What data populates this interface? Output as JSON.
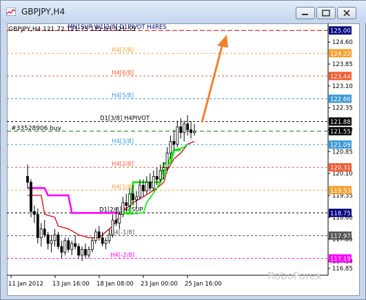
{
  "window": {
    "title": "GBPJPY,H4",
    "minimize_icon": "minimize-icon",
    "maximize_icon": "maximize-icon",
    "close_icon": "close-icon",
    "app_icon": "chart-icon"
  },
  "chart_info": {
    "symbol_line": "GBPJPY,H4  121.72 121.75 121.53 121.55",
    "order_label": "#33528906 buy",
    "watermark": "RoboForex"
  },
  "colors": {
    "candles": "#000000",
    "red_line": "#d40000",
    "magenta_line": "#ff00ff",
    "green_line": "#00ee00",
    "arrow": "#f47f2a"
  },
  "levels": [
    {
      "price": 125.0,
      "label": "MN1SUP W1[2/8] D1PIVOT H4RES",
      "tag": "125.00",
      "color": "#c80000",
      "tagcolor": "#000080",
      "style": "long"
    },
    {
      "price": 124.22,
      "label": "H4[7/8]",
      "tag": "124.22",
      "color": "#f5a030",
      "tagcolor": "#f5a030",
      "style": "dash"
    },
    {
      "price": 123.44,
      "label": "H4[6/8]",
      "tag": "123.44",
      "color": "#f05a30",
      "tagcolor": "#f05a30",
      "style": "dash"
    },
    {
      "price": 122.66,
      "label": "H4[5/8]",
      "tag": "122.66",
      "color": "#3a9ad9",
      "tagcolor": "#3a9ad9",
      "style": "dash"
    },
    {
      "price": 121.88,
      "label": "D1[3/8] H4PIVOT",
      "tag": "121.88",
      "color": "#000000",
      "tagcolor": "#000000",
      "style": "dash"
    },
    {
      "price": 121.09,
      "label": "H4[3/8]",
      "tag": "121.09",
      "color": "#3a9ad9",
      "tagcolor": "#3a9ad9",
      "style": "dash"
    },
    {
      "price": 120.31,
      "label": "H4[2/8]",
      "tag": "120.31",
      "color": "#f05a30",
      "tagcolor": "#f05a30",
      "style": "dash"
    },
    {
      "price": 119.53,
      "label": "H4[1/8]",
      "tag": "119.53",
      "color": "#f5a030",
      "tagcolor": "#f5a030",
      "style": "dash"
    },
    {
      "price": 118.75,
      "label": "D1[2/8] H4SUP",
      "tag": "118.75",
      "color": "#000000",
      "tagcolor": "#000080",
      "style": "dash"
    },
    {
      "price": 117.97,
      "label": "H4[-1/8]",
      "tag": "117.97",
      "color": "#555555",
      "tagcolor": "#555555",
      "style": "dash"
    },
    {
      "price": 117.19,
      "label": "H4[-2/8]",
      "tag": "117.19",
      "color": "#ff00ff",
      "tagcolor": "#ff00ff",
      "style": "dash"
    }
  ],
  "current_price": {
    "price": 121.55,
    "tag": "121.55"
  },
  "axis": {
    "y_ticks": [
      "124.60",
      "123.85",
      "123.10",
      "122.35",
      "121.60",
      "120.85",
      "120.10",
      "119.35",
      "118.60",
      "117.85",
      "117.10",
      "116.85"
    ],
    "y_tick_values": [
      124.6,
      123.85,
      123.1,
      122.35,
      121.6,
      120.85,
      120.1,
      119.35,
      118.6,
      117.85,
      117.1,
      116.85
    ],
    "x_ticks": [
      "11 Jan 2012",
      "13 Jan 16:00",
      "18 Jan 08:00",
      "23 Jan 00:00",
      "25 Jan 16:00"
    ],
    "ymin": 116.85,
    "ymax": 125.1
  },
  "candles": [
    [
      120.0,
      120.4,
      119.6,
      119.8
    ],
    [
      119.8,
      119.9,
      118.6,
      118.8
    ],
    [
      118.8,
      119.0,
      118.4,
      118.7
    ],
    [
      118.7,
      118.9,
      117.7,
      117.9
    ],
    [
      117.9,
      118.4,
      117.6,
      118.2
    ],
    [
      118.2,
      118.5,
      117.9,
      118.0
    ],
    [
      118.0,
      118.1,
      117.5,
      117.7
    ],
    [
      117.7,
      118.0,
      117.4,
      117.8
    ],
    [
      117.8,
      118.2,
      117.6,
      118.0
    ],
    [
      118.0,
      118.1,
      117.5,
      117.6
    ],
    [
      117.6,
      117.8,
      117.2,
      117.4
    ],
    [
      117.4,
      117.9,
      117.3,
      117.8
    ],
    [
      117.8,
      117.9,
      117.4,
      117.5
    ],
    [
      117.5,
      117.8,
      117.3,
      117.7
    ],
    [
      117.7,
      118.0,
      117.5,
      117.6
    ],
    [
      117.6,
      117.7,
      117.2,
      117.3
    ],
    [
      117.3,
      117.6,
      117.1,
      117.5
    ],
    [
      117.5,
      117.7,
      117.2,
      117.3
    ],
    [
      117.3,
      117.6,
      117.2,
      117.5
    ],
    [
      117.5,
      117.9,
      117.4,
      117.8
    ],
    [
      117.8,
      118.2,
      117.7,
      118.1
    ],
    [
      118.1,
      118.3,
      117.8,
      117.9
    ],
    [
      117.9,
      118.1,
      117.6,
      117.7
    ],
    [
      117.7,
      117.9,
      117.5,
      117.8
    ],
    [
      117.8,
      118.2,
      117.7,
      118.0
    ],
    [
      118.0,
      118.7,
      117.9,
      118.5
    ],
    [
      118.5,
      118.9,
      118.3,
      118.4
    ],
    [
      118.4,
      118.8,
      118.2,
      118.7
    ],
    [
      118.7,
      119.3,
      118.6,
      119.1
    ],
    [
      119.1,
      119.4,
      118.8,
      119.0
    ],
    [
      119.0,
      119.6,
      118.9,
      119.4
    ],
    [
      119.4,
      119.7,
      119.0,
      119.2
    ],
    [
      119.2,
      119.5,
      118.9,
      119.3
    ],
    [
      119.3,
      119.9,
      119.2,
      119.7
    ],
    [
      119.7,
      119.9,
      119.3,
      119.5
    ],
    [
      119.5,
      120.0,
      119.4,
      119.8
    ],
    [
      119.8,
      120.1,
      119.5,
      119.6
    ],
    [
      119.6,
      120.2,
      119.5,
      120.0
    ],
    [
      120.0,
      120.3,
      119.7,
      119.9
    ],
    [
      119.9,
      120.4,
      119.8,
      120.2
    ],
    [
      120.2,
      120.5,
      119.9,
      120.3
    ],
    [
      120.3,
      121.0,
      120.2,
      120.8
    ],
    [
      120.8,
      121.4,
      120.6,
      121.2
    ],
    [
      121.2,
      121.6,
      120.9,
      121.1
    ],
    [
      121.1,
      121.9,
      121.0,
      121.7
    ],
    [
      121.7,
      122.0,
      121.3,
      121.5
    ],
    [
      121.5,
      121.9,
      121.2,
      121.8
    ],
    [
      121.8,
      122.1,
      121.4,
      121.6
    ],
    [
      121.6,
      121.9,
      121.3,
      121.5
    ],
    [
      121.5,
      121.8,
      121.4,
      121.55
    ]
  ],
  "red_line": [
    [
      0,
      119.35
    ],
    [
      4,
      119.35
    ],
    [
      5,
      118.7
    ],
    [
      8,
      118.6
    ],
    [
      9,
      118.3
    ],
    [
      12,
      118.2
    ],
    [
      15,
      118.0
    ],
    [
      18,
      117.9
    ],
    [
      21,
      117.9
    ],
    [
      22,
      118.0
    ],
    [
      25,
      118.3
    ],
    [
      28,
      118.8
    ],
    [
      31,
      119.1
    ],
    [
      34,
      119.3
    ],
    [
      38,
      119.6
    ],
    [
      40,
      119.8
    ],
    [
      41,
      120.2
    ],
    [
      43,
      120.6
    ],
    [
      45,
      120.8
    ],
    [
      47,
      121.1
    ],
    [
      49,
      121.2
    ]
  ],
  "magenta_line": [
    [
      0,
      119.6
    ],
    [
      5,
      119.6
    ],
    [
      6,
      119.35
    ],
    [
      12,
      119.35
    ],
    [
      13,
      118.75
    ],
    [
      27,
      118.75
    ]
  ],
  "green_line_1": [
    [
      27,
      118.75
    ],
    [
      30,
      118.75
    ],
    [
      31,
      119.8
    ],
    [
      39,
      119.8
    ],
    [
      40,
      120.45
    ],
    [
      42,
      120.45
    ],
    [
      43,
      120.9
    ],
    [
      45,
      120.9
    ]
  ],
  "green_line_2": [
    [
      29,
      118.7
    ],
    [
      34,
      118.75
    ],
    [
      35,
      119.1
    ],
    [
      38,
      119.6
    ],
    [
      40,
      120.0
    ],
    [
      42,
      120.7
    ],
    [
      43,
      120.9
    ],
    [
      46,
      121.0
    ],
    [
      47,
      121.1
    ]
  ]
}
